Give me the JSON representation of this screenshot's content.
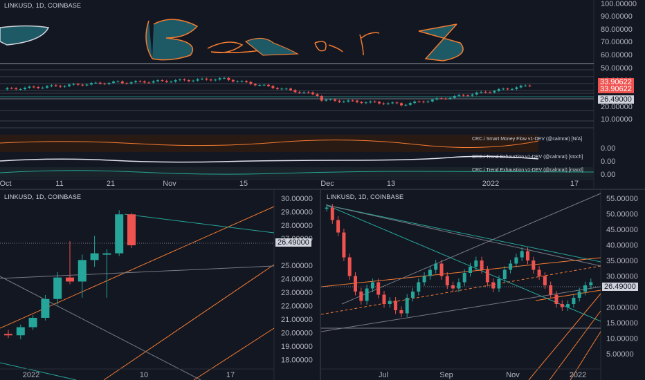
{
  "colors": {
    "bg": "#131722",
    "up": "#26a69a",
    "down": "#ef5350",
    "text": "#b2b5be",
    "teal": "#26a69a",
    "orange": "#f57c31",
    "grid": "#2a2e39",
    "white": "#d1d4dc"
  },
  "top_pane": {
    "symbol": "LINKUSD, 1D, COINBASE",
    "drawing_text": "Bears",
    "price_ticks": [
      "100.00000",
      "90.00000",
      "80.00000",
      "70.00000",
      "60.00000",
      "50.00000",
      "40.00000",
      "20.00000",
      "10.00000"
    ],
    "tag_red_1": "33.90622",
    "tag_red_2": "33.90622",
    "tag_price": "26.49000",
    "indicators": [
      "CRC.i Smart Money Flow v1-DEV (@calmrat) [N/A]",
      "CRC.i Trend Exhaustion v1-DEV (@calmrat) [stoch]",
      "CRC.i Trend Exhaustion v1-DEV (@calmrat) [macd]"
    ],
    "ind_values": [
      "0.00",
      "0.00",
      "0.00"
    ],
    "x_ticks": [
      "Oct",
      "11",
      "21",
      "Nov",
      "15",
      "Dec",
      "13",
      "2022",
      "17"
    ]
  },
  "bl_pane": {
    "symbol": "LINKUSD, 1D, COINBASE",
    "price_ticks": [
      "30.00000",
      "29.00000",
      "28.00000",
      "27.00000",
      "25.00000",
      "24.00000",
      "23.00000",
      "22.00000",
      "21.00000",
      "20.00000",
      "19.00000",
      "18.00000"
    ],
    "tag_price": "26.49000",
    "x_ticks": [
      "2022",
      "10",
      "17"
    ]
  },
  "br_pane": {
    "symbol": "LINKUSD, 1D, COINBASE",
    "price_ticks": [
      "55.00000",
      "50.00000",
      "45.00000",
      "40.00000",
      "35.00000",
      "30.00000",
      "20.00000",
      "15.00000",
      "10.00000",
      "5.00000"
    ],
    "tag_price": "26.49000",
    "x_ticks": [
      "Jul",
      "Sep",
      "Nov",
      "2022"
    ]
  },
  "chart_data": [
    {
      "type": "candlestick",
      "title": "LINKUSD, 1D, COINBASE",
      "series": [
        {
          "name": "LINKUSD",
          "values_ohlc": [
            [
              19.9,
              20.2,
              19.6,
              19.8
            ],
            [
              19.8,
              20.6,
              19.5,
              20.4
            ],
            [
              20.4,
              21.3,
              20.2,
              21.1
            ],
            [
              21.1,
              22.8,
              20.9,
              22.5
            ],
            [
              22.5,
              24.5,
              22.1,
              24.1
            ],
            [
              24.1,
              26.8,
              23.6,
              23.8
            ],
            [
              23.8,
              25.8,
              22.6,
              25.4
            ],
            [
              25.4,
              27.2,
              24.9,
              25.9
            ],
            [
              25.9,
              26.2,
              22.6,
              25.9
            ],
            [
              25.9,
              29.1,
              25.7,
              28.8
            ],
            [
              28.8,
              28.9,
              26.3,
              26.5
            ]
          ]
        }
      ],
      "x_ticks": [
        "2022",
        "10",
        "17"
      ],
      "ylim": [
        17.5,
        30.2
      ]
    }
  ]
}
